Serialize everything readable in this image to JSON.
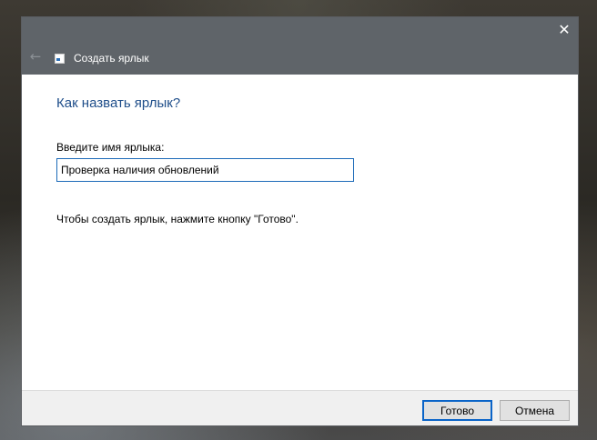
{
  "window": {
    "title": "Создать ярлык",
    "close_glyph": "✕",
    "back_glyph": "←",
    "icons": [
      "back-arrow-icon",
      "shortcut-app-icon",
      "close-icon"
    ]
  },
  "content": {
    "heading": "Как назвать ярлык?",
    "name_label": "Введите имя ярлыка:",
    "name_value": "Проверка наличия обновлений",
    "hint": "Чтобы создать ярлык, нажмите кнопку \"Готово\"."
  },
  "footer": {
    "finish_label": "Готово",
    "cancel_label": "Отмена"
  },
  "colors": {
    "titlebar": "#5f6469",
    "heading": "#1f4e8a",
    "accent": "#0a64c8"
  }
}
